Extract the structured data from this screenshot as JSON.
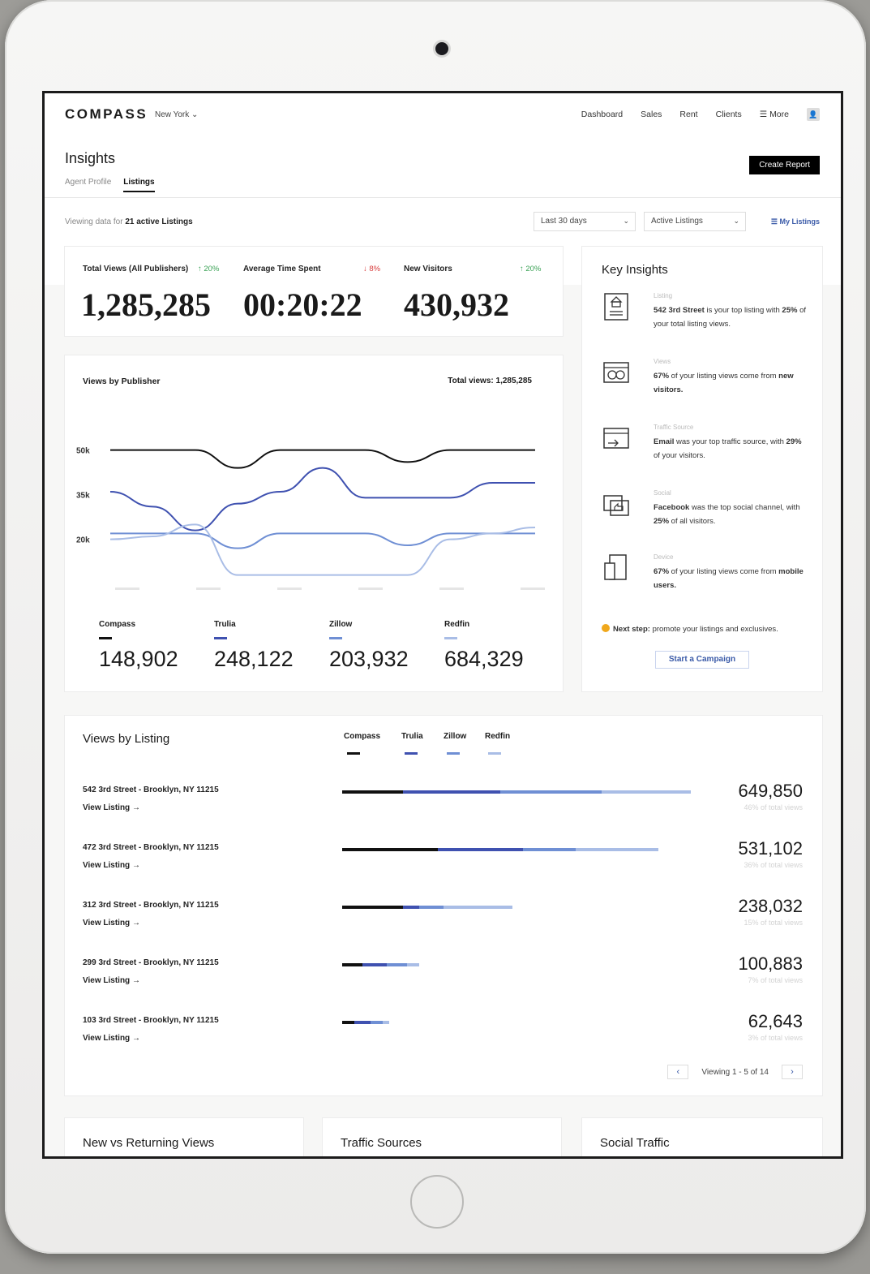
{
  "nav": {
    "logo": "COMPASS",
    "city": "New York",
    "links": [
      "Dashboard",
      "Sales",
      "Rent",
      "Clients",
      "More"
    ],
    "avatar_icon": "user-icon"
  },
  "page": {
    "title": "Insights",
    "tabs": [
      "Agent Profile",
      "Listings"
    ],
    "active_tab": "Listings",
    "create_report": "Create Report"
  },
  "filters": {
    "viewing_prefix": "Viewing data for",
    "viewing_count": "21 active Listings",
    "date_range": "Last 30 days",
    "listing_filter": "Active Listings",
    "my_listings": "My Listings"
  },
  "stats": [
    {
      "label": "Total Views (All Publishers)",
      "delta": "↑ 20%",
      "direction": "up",
      "value": "1,285,285"
    },
    {
      "label": "Average Time Spent",
      "delta": "↓ 8%",
      "direction": "down",
      "value": "00:20:22"
    },
    {
      "label": "New Visitors",
      "delta": "↑ 20%",
      "direction": "up",
      "value": "430,932"
    }
  ],
  "views_by_publisher": {
    "title": "Views by Publisher",
    "total": "Total views: 1,285,285",
    "publishers": [
      {
        "name": "Compass",
        "value": "148,902",
        "color": "#111111"
      },
      {
        "name": "Trulia",
        "value": "248,122",
        "color": "#3f51b0"
      },
      {
        "name": "Zillow",
        "value": "203,932",
        "color": "#6f8fd4"
      },
      {
        "name": "Redfin",
        "value": "684,329",
        "color": "#a9bde6"
      }
    ]
  },
  "chart_data": {
    "type": "line",
    "title": "Views by Publisher",
    "xlabel": "",
    "ylabel": "",
    "y_ticks": [
      "50k",
      "35k",
      "20k"
    ],
    "x": [
      0,
      1,
      2,
      3,
      4,
      5,
      6,
      7,
      8,
      9,
      10
    ],
    "series": [
      {
        "name": "Compass",
        "color": "#111111",
        "values": [
          50,
          50,
          50,
          44,
          50,
          50,
          50,
          46,
          50,
          50,
          50
        ]
      },
      {
        "name": "Trulia",
        "color": "#3f51b0",
        "values": [
          36,
          31,
          23,
          32,
          36,
          44,
          34,
          34,
          34,
          39,
          39
        ]
      },
      {
        "name": "Zillow",
        "color": "#6f8fd4",
        "values": [
          22,
          22,
          22,
          17,
          22,
          22,
          22,
          18,
          22,
          22,
          22
        ]
      },
      {
        "name": "Redfin",
        "color": "#a9bde6",
        "values": [
          20,
          21,
          25,
          8,
          8,
          8,
          8,
          8,
          20,
          22,
          24
        ]
      }
    ],
    "ylim": [
      0,
      60
    ]
  },
  "key_insights": {
    "title": "Key Insights",
    "items": [
      {
        "category": "Listing",
        "icon": "listing-icon",
        "text_bold": "542 3rd Street",
        "text": " is your top listing with ",
        "text_bold2": "25%",
        "text2": " of your total listing views."
      },
      {
        "category": "Views",
        "icon": "views-icon",
        "text_bold": "67%",
        "text": " of your listing views come from ",
        "text_bold2": "new visitors.",
        "text2": ""
      },
      {
        "category": "Traffic Source",
        "icon": "traffic-source-icon",
        "text_bold": "Email",
        "text": " was your top traffic source, with ",
        "text_bold2": "29%",
        "text2": " of your visitors."
      },
      {
        "category": "Social",
        "icon": "social-icon",
        "text_bold": "Facebook",
        "text": " was the top social channel, with ",
        "text_bold2": "25%",
        "text2": " of all visitors."
      },
      {
        "category": "Device",
        "icon": "device-icon",
        "text_bold": "67%",
        "text": " of your listing views come from ",
        "text_bold2": "mobile users.",
        "text2": ""
      }
    ],
    "next_step_label": "Next step:",
    "next_step": " promote your listings and exclusives.",
    "campaign_button": "Start a Campaign"
  },
  "views_by_listing": {
    "title": "Views by Listing",
    "legend": [
      "Compass",
      "Trulia",
      "Zillow",
      "Redfin"
    ],
    "view_listing": "View Listing →",
    "rows": [
      {
        "address": "542 3rd Street - Brooklyn, NY 11215",
        "value": "649,850",
        "pct": "46% of total views",
        "segments": [
          75,
          120,
          125,
          110
        ]
      },
      {
        "address": "472 3rd Street - Brooklyn, NY 11215",
        "value": "531,102",
        "pct": "36% of total views",
        "segments": [
          118,
          105,
          65,
          102
        ]
      },
      {
        "address": "312 3rd Street - Brooklyn, NY 11215",
        "value": "238,032",
        "pct": "15% of total views",
        "segments": [
          75,
          20,
          30,
          85
        ]
      },
      {
        "address": "299 3rd Street - Brooklyn, NY 11215",
        "value": "100,883",
        "pct": "7% of total views",
        "segments": [
          25,
          30,
          25,
          15
        ]
      },
      {
        "address": "103 3rd Street - Brooklyn, NY 11215",
        "value": "62,643",
        "pct": "3% of total views",
        "segments": [
          15,
          20,
          15,
          8
        ]
      }
    ],
    "pager_text": "Viewing 1 - 5 of 14"
  },
  "bottom_cards": [
    "New vs Returning Views",
    "Traffic Sources",
    "Social Traffic"
  ]
}
